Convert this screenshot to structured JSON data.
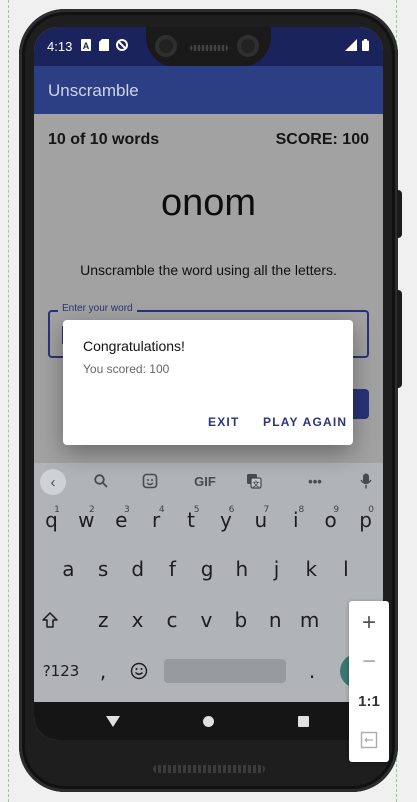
{
  "status_bar": {
    "time": "4:13",
    "icons": [
      "notification-a-icon",
      "sd-card-icon",
      "sync-icon"
    ],
    "right_icons": [
      "signal-icon",
      "battery-icon"
    ]
  },
  "app_bar": {
    "title": "Unscramble"
  },
  "game": {
    "word_count": "10 of 10 words",
    "score": "SCORE: 100",
    "scrambled_word": "onom",
    "instructions": "Unscramble the word using all the letters.",
    "input_label": "Enter your word",
    "input_value": ""
  },
  "dialog": {
    "title": "Congratulations!",
    "message": "You scored: 100",
    "exit_label": "EXIT",
    "play_again_label": "PLAY AGAIN"
  },
  "keyboard": {
    "toolbar": {
      "gif_label": "GIF",
      "more_label": "•••"
    },
    "row1": [
      {
        "k": "q",
        "n": "1"
      },
      {
        "k": "w",
        "n": "2"
      },
      {
        "k": "e",
        "n": "3"
      },
      {
        "k": "r",
        "n": "4"
      },
      {
        "k": "t",
        "n": "5"
      },
      {
        "k": "y",
        "n": "6"
      },
      {
        "k": "u",
        "n": "7"
      },
      {
        "k": "i",
        "n": "8"
      },
      {
        "k": "o",
        "n": "9"
      },
      {
        "k": "p",
        "n": "0"
      }
    ],
    "row2": [
      "a",
      "s",
      "d",
      "f",
      "g",
      "h",
      "j",
      "k",
      "l"
    ],
    "row3": [
      "z",
      "x",
      "c",
      "v",
      "b",
      "n",
      "m"
    ],
    "bottom": {
      "symbols_label": "?123",
      "comma": ",",
      "period": "."
    }
  },
  "zoom_controls": {
    "zoom_in": "+",
    "zoom_out": "−",
    "actual_size": "1:1"
  }
}
